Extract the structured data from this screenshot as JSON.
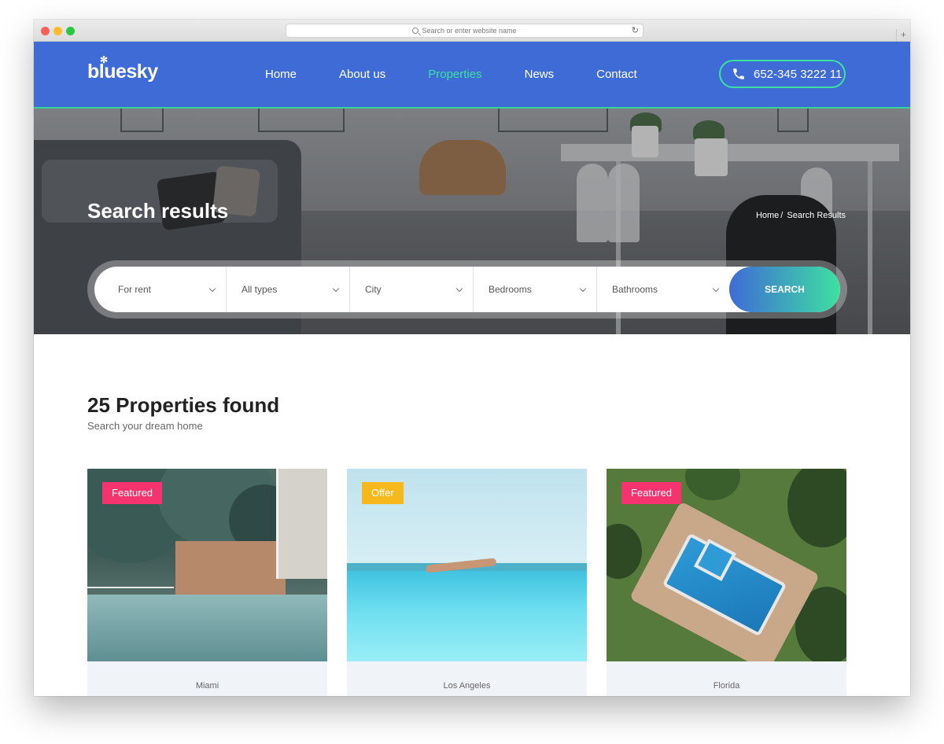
{
  "browser": {
    "address_placeholder": "Search or enter website name",
    "new_tab": "+",
    "reload": "↻"
  },
  "brand": {
    "logo": "bluesky"
  },
  "nav": {
    "items": [
      {
        "label": "Home"
      },
      {
        "label": "About us"
      },
      {
        "label": "Properties",
        "active": true
      },
      {
        "label": "News"
      },
      {
        "label": "Contact"
      }
    ]
  },
  "header": {
    "phone": "652-345 3222 11"
  },
  "hero": {
    "title": "Search results",
    "breadcrumb": {
      "home": "Home",
      "separator": "/",
      "current": "Search Results"
    }
  },
  "search": {
    "fields": [
      {
        "value": "For rent"
      },
      {
        "value": "All types"
      },
      {
        "value": "City"
      },
      {
        "value": "Bedrooms"
      },
      {
        "value": "Bathrooms"
      }
    ],
    "button_label": "SEARCH"
  },
  "results": {
    "title": "25 Properties found",
    "subtitle": "Search your dream home",
    "cards": [
      {
        "badge": "Featured",
        "badge_color": "#f5336e",
        "city": "Miami"
      },
      {
        "badge": "Offer",
        "badge_color": "#f7b81d",
        "city": "Los Angeles"
      },
      {
        "badge": "Featured",
        "badge_color": "#f5336e",
        "city": "Florida"
      }
    ]
  },
  "colors": {
    "header_bg": "#3f6bd6",
    "accent_green": "#3ee0a1",
    "featured_badge": "#f5336e",
    "offer_badge": "#f7b81d"
  }
}
